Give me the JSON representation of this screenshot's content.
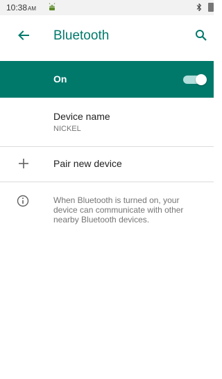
{
  "status_bar": {
    "time": "10:38",
    "ampm": "AM",
    "notification_icon": "android-icon",
    "bluetooth_icon": "bluetooth-icon",
    "battery_icon": "battery-icon"
  },
  "app_bar": {
    "title": "Bluetooth",
    "back_icon": "back-arrow-icon",
    "search_icon": "search-icon",
    "accent_color": "#00796b"
  },
  "bluetooth_toggle": {
    "label": "On",
    "state": "on",
    "background_color": "#00796b"
  },
  "device_name": {
    "title": "Device name",
    "value": "NICKEL"
  },
  "pair_new_device": {
    "icon": "plus-icon",
    "label": "Pair new device"
  },
  "info": {
    "icon": "info-icon",
    "text": "When Bluetooth is turned on, your device can communicate with other nearby Bluetooth devices."
  }
}
